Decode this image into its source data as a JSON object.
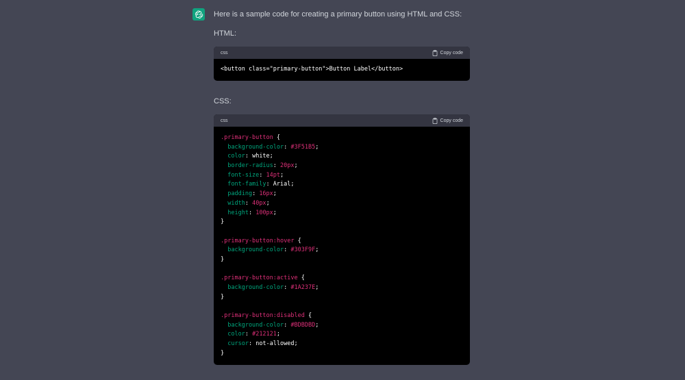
{
  "message": {
    "intro": "Here is a sample code for creating a primary button using HTML and CSS:",
    "html_label": "HTML:",
    "css_label": "CSS:"
  },
  "code_blocks": [
    {
      "language": "css",
      "copy_label": "Copy code",
      "lines": [
        [
          {
            "t": "<button class=\"primary-button\">Button Label</button>",
            "c": "val-kw"
          }
        ]
      ]
    },
    {
      "language": "css",
      "copy_label": "Copy code",
      "lines": [
        [
          {
            "t": ".primary-button",
            "c": "sel"
          },
          {
            "t": " {",
            "c": "punc"
          }
        ],
        [
          {
            "t": "  background-color",
            "c": "prop2"
          },
          {
            "t": ": ",
            "c": "punc"
          },
          {
            "t": "#3F51B5",
            "c": "val-num"
          },
          {
            "t": ";",
            "c": "punc"
          }
        ],
        [
          {
            "t": "  color",
            "c": "prop2"
          },
          {
            "t": ": ",
            "c": "punc"
          },
          {
            "t": "white",
            "c": "val-kw"
          },
          {
            "t": ";",
            "c": "punc"
          }
        ],
        [
          {
            "t": "  border-radius",
            "c": "prop2"
          },
          {
            "t": ": ",
            "c": "punc"
          },
          {
            "t": "20px",
            "c": "val-num"
          },
          {
            "t": ";",
            "c": "punc"
          }
        ],
        [
          {
            "t": "  font-size",
            "c": "prop2"
          },
          {
            "t": ": ",
            "c": "punc"
          },
          {
            "t": "14pt",
            "c": "val-num"
          },
          {
            "t": ";",
            "c": "punc"
          }
        ],
        [
          {
            "t": "  font-family",
            "c": "prop2"
          },
          {
            "t": ": ",
            "c": "punc"
          },
          {
            "t": "Arial",
            "c": "val-kw"
          },
          {
            "t": ";",
            "c": "punc"
          }
        ],
        [
          {
            "t": "  padding",
            "c": "prop2"
          },
          {
            "t": ": ",
            "c": "punc"
          },
          {
            "t": "16px",
            "c": "val-num"
          },
          {
            "t": ";",
            "c": "punc"
          }
        ],
        [
          {
            "t": "  width",
            "c": "prop2"
          },
          {
            "t": ": ",
            "c": "punc"
          },
          {
            "t": "40px",
            "c": "val-num"
          },
          {
            "t": ";",
            "c": "punc"
          }
        ],
        [
          {
            "t": "  height",
            "c": "prop2"
          },
          {
            "t": ": ",
            "c": "punc"
          },
          {
            "t": "100px",
            "c": "val-num"
          },
          {
            "t": ";",
            "c": "punc"
          }
        ],
        [
          {
            "t": "}",
            "c": "punc"
          }
        ],
        [
          {
            "t": "",
            "c": "punc"
          }
        ],
        [
          {
            "t": ".primary-button:hover",
            "c": "sel"
          },
          {
            "t": " {",
            "c": "punc"
          }
        ],
        [
          {
            "t": "  background-color",
            "c": "prop2"
          },
          {
            "t": ": ",
            "c": "punc"
          },
          {
            "t": "#303F9F",
            "c": "val-num"
          },
          {
            "t": ";",
            "c": "punc"
          }
        ],
        [
          {
            "t": "}",
            "c": "punc"
          }
        ],
        [
          {
            "t": "",
            "c": "punc"
          }
        ],
        [
          {
            "t": ".primary-button:active",
            "c": "sel"
          },
          {
            "t": " {",
            "c": "punc"
          }
        ],
        [
          {
            "t": "  background-color",
            "c": "prop2"
          },
          {
            "t": ": ",
            "c": "punc"
          },
          {
            "t": "#1A237E",
            "c": "val-num"
          },
          {
            "t": ";",
            "c": "punc"
          }
        ],
        [
          {
            "t": "}",
            "c": "punc"
          }
        ],
        [
          {
            "t": "",
            "c": "punc"
          }
        ],
        [
          {
            "t": ".primary-button:disabled",
            "c": "sel"
          },
          {
            "t": " {",
            "c": "punc"
          }
        ],
        [
          {
            "t": "  background-color",
            "c": "prop2"
          },
          {
            "t": ": ",
            "c": "punc"
          },
          {
            "t": "#BDBDBD",
            "c": "val-num"
          },
          {
            "t": ";",
            "c": "punc"
          }
        ],
        [
          {
            "t": "  color",
            "c": "prop2"
          },
          {
            "t": ": ",
            "c": "punc"
          },
          {
            "t": "#212121",
            "c": "val-num"
          },
          {
            "t": ";",
            "c": "punc"
          }
        ],
        [
          {
            "t": "  cursor",
            "c": "prop2"
          },
          {
            "t": ": ",
            "c": "punc"
          },
          {
            "t": "not-allowed",
            "c": "val-kw"
          },
          {
            "t": ";",
            "c": "punc"
          }
        ],
        [
          {
            "t": "}",
            "c": "punc"
          }
        ]
      ]
    }
  ],
  "icons": {
    "avatar": "openai-logo-icon",
    "copy": "clipboard-icon"
  },
  "colors": {
    "background": "#444654",
    "avatar_bg": "#10a37f",
    "code_bg": "#000000",
    "code_header_bg": "#343541",
    "selector": "#df3079",
    "property": "#00a67d",
    "value_number": "#df3079",
    "value_keyword": "#ffffff"
  }
}
